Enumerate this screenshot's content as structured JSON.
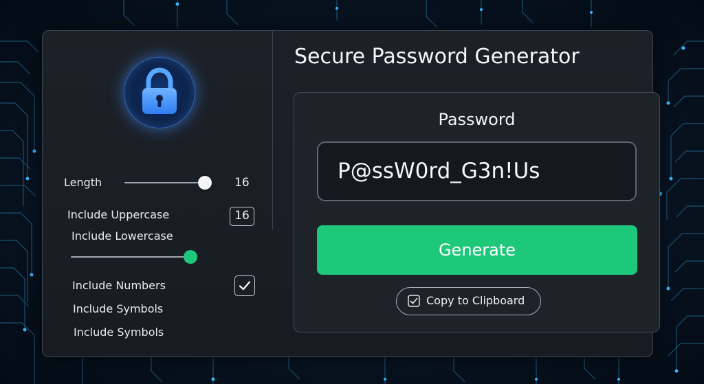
{
  "window": {
    "title": "Secure Password Generator"
  },
  "icons": {
    "lock": "lock-icon",
    "checkbox_check": "checkmark-icon",
    "copy": "checkbox-icon"
  },
  "colors": {
    "accent_green": "#1ec87a",
    "lock_glow": "#3d8bff",
    "background": "#06111c",
    "panel": "#1e232a"
  },
  "settings": {
    "length_label": "Length",
    "length_value": "16",
    "length_slider_fraction": 0.95,
    "uppercase_label": "Include Uppercase",
    "uppercase_value": "16",
    "lowercase_label": "Include Lowercase",
    "lowercase_slider_fraction": 1.0,
    "numbers_label": "Include Numbers",
    "numbers_checked": true,
    "symbols_label": "Include Symbols",
    "symbols_label_2": "Include Symbols"
  },
  "main": {
    "password_heading": "Password",
    "password_value": "P@ssW0rd_G3n!Us",
    "generate_label": "Generate",
    "copy_label": "Copy to Clipboard"
  }
}
